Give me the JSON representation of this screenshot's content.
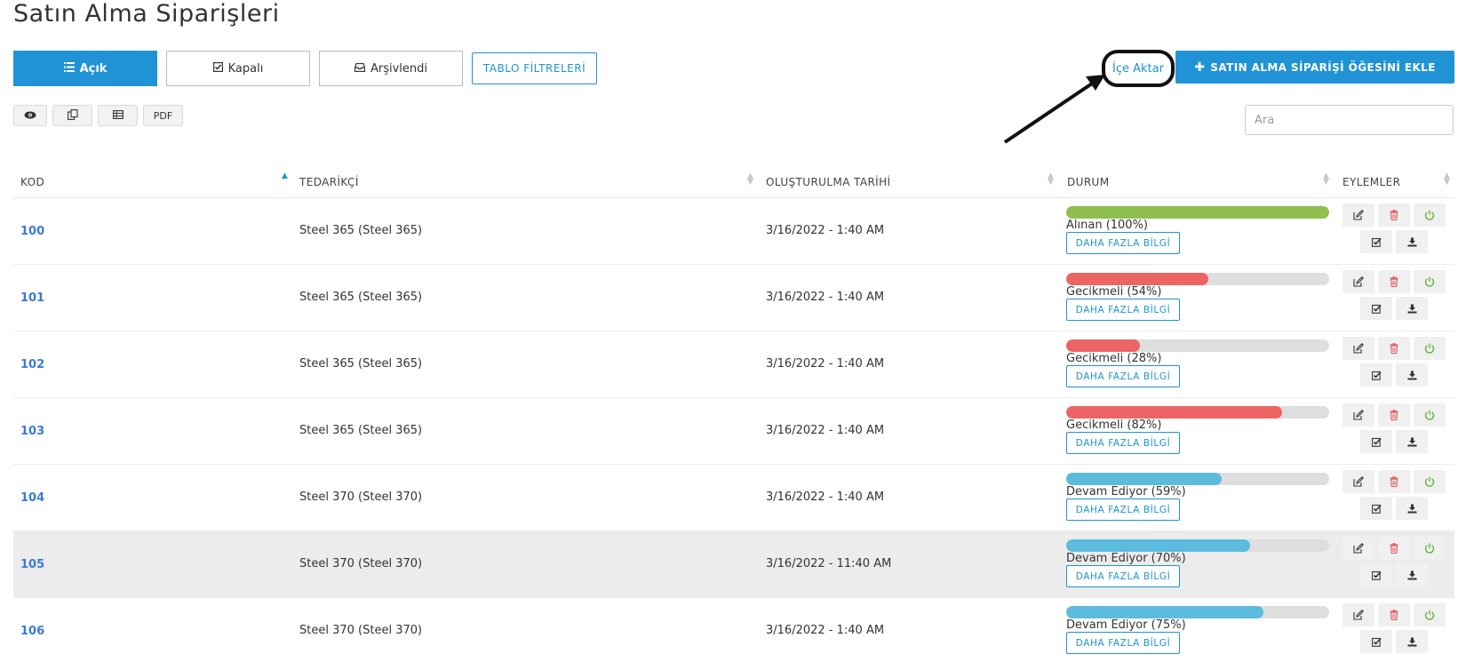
{
  "page": {
    "title": "Satın Alma Siparişleri"
  },
  "tabs": {
    "open_label": "Açık",
    "closed_label": "Kapalı",
    "archived_label": "Arşivlendi",
    "filters_label": "TABLO FİLTRELERİ"
  },
  "toolbar": {
    "import_label": "İçe Aktar",
    "add_label": "SATIN ALMA SİPARİŞİ ÖĞESİNİ EKLE",
    "pdf_label": "PDF",
    "search_placeholder": "Ara"
  },
  "icons": {
    "open": "list-icon",
    "closed": "check-square-icon",
    "archived": "inbox-icon",
    "add": "plus-icon",
    "view": "eye-icon",
    "copy": "copy-icon",
    "table": "table-icon",
    "edit": "edit-icon",
    "delete": "trash-icon",
    "power": "power-icon",
    "approve": "check-square-icon",
    "download": "download-icon"
  },
  "table": {
    "columns": {
      "code": "KOD",
      "supplier": "TEDARİKÇİ",
      "created": "OLUŞTURULMA TARİHİ",
      "status": "DURUM",
      "actions": "EYLEMLER"
    },
    "info_label": "DAHA FAZLA BİLGİ",
    "rows": [
      {
        "code": "100",
        "supplier": "Steel 365 (Steel 365)",
        "date": "3/16/2022 - 1:40 AM",
        "status": "Alınan (100%)",
        "progress": 100,
        "color": "#8fbf4d"
      },
      {
        "code": "101",
        "supplier": "Steel 365 (Steel 365)",
        "date": "3/16/2022 - 1:40 AM",
        "status": "Gecikmeli (54%)",
        "progress": 54,
        "color": "#ec6464"
      },
      {
        "code": "102",
        "supplier": "Steel 365 (Steel 365)",
        "date": "3/16/2022 - 1:40 AM",
        "status": "Gecikmeli (28%)",
        "progress": 28,
        "color": "#ec6464"
      },
      {
        "code": "103",
        "supplier": "Steel 365 (Steel 365)",
        "date": "3/16/2022 - 1:40 AM",
        "status": "Gecikmeli (82%)",
        "progress": 82,
        "color": "#ec6464"
      },
      {
        "code": "104",
        "supplier": "Steel 370 (Steel 370)",
        "date": "3/16/2022 - 1:40 AM",
        "status": "Devam Ediyor (59%)",
        "progress": 59,
        "color": "#5bbcdd"
      },
      {
        "code": "105",
        "supplier": "Steel 370 (Steel 370)",
        "date": "3/16/2022 - 11:40 AM",
        "status": "Devam Ediyor (70%)",
        "progress": 70,
        "color": "#5bbcdd"
      },
      {
        "code": "106",
        "supplier": "Steel 370 (Steel 370)",
        "date": "3/16/2022 - 1:40 AM",
        "status": "Devam Ediyor (75%)",
        "progress": 75,
        "color": "#5bbcdd"
      }
    ]
  },
  "colors": {
    "primary": "#1f93d6",
    "link": "#3a7ad9",
    "danger": "#e05a5a",
    "success": "#6cb33f"
  }
}
